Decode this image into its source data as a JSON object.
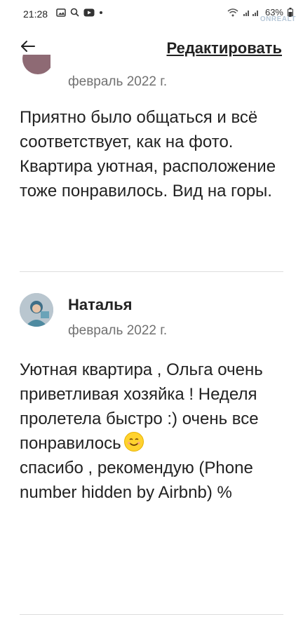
{
  "status_bar": {
    "time": "21:28",
    "battery": "63%",
    "watermark": "ONREALT"
  },
  "header": {
    "edit_label": "Редактировать"
  },
  "reviews": [
    {
      "date": "февраль 2022 г.",
      "text": "Приятно было общаться и всё соответствует, как на фото. Квартира уютная, расположение тоже понравилось. Вид на горы."
    },
    {
      "name": "Наталья",
      "date": "февраль 2022 г.",
      "text_line1": "Уютная квартира , Ольга очень приветливая хозяйка ! Неделя пролетела быстро :)  очень все понравилось",
      "text_line2": "спасибо , рекомендую (Phone number hidden by Airbnb) %"
    }
  ]
}
